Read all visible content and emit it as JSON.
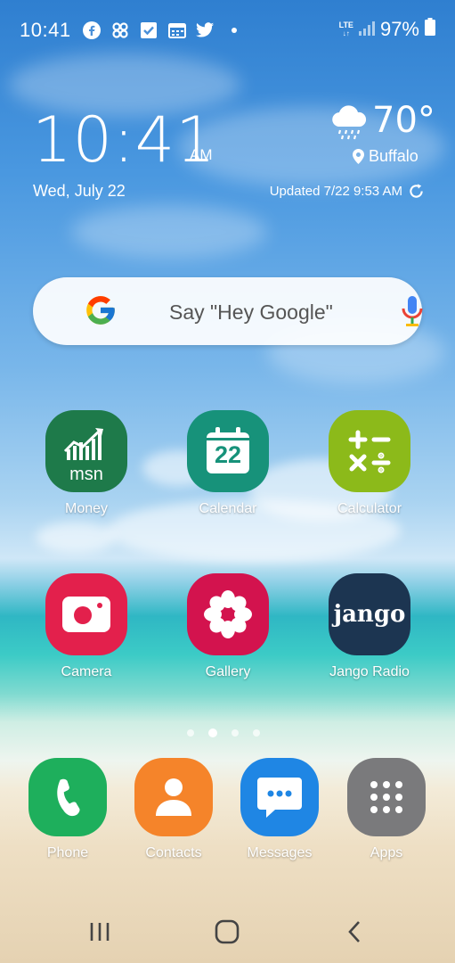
{
  "status_bar": {
    "time": "10:41",
    "network": "LTE",
    "battery": "97%",
    "icons": [
      "facebook-icon",
      "pinwheel-icon",
      "check-icon",
      "calendar-icon",
      "twitter-icon",
      "dot-icon"
    ]
  },
  "clock_widget": {
    "time": "10:41",
    "ampm": "AM",
    "date": "Wed, July 22"
  },
  "weather_widget": {
    "temperature": "70°",
    "location": "Buffalo",
    "updated": "Updated 7/22 9:53 AM",
    "icon": "rain-cloud-icon"
  },
  "search": {
    "placeholder": "Say \"Hey Google\""
  },
  "apps": [
    {
      "label": "Money",
      "color": "#1e7a4a"
    },
    {
      "label": "Calendar",
      "color": "#17927a",
      "day": "22"
    },
    {
      "label": "Calculator",
      "color": "#8cba1a"
    },
    {
      "label": "Camera",
      "color": "#e3204c"
    },
    {
      "label": "Gallery",
      "color": "#d3134e"
    },
    {
      "label": "Jango Radio",
      "color": "#1c3551",
      "logo_text": "jango"
    }
  ],
  "money_icon_text": "msn",
  "dock": [
    {
      "label": "Phone",
      "color": "#1eaf5c"
    },
    {
      "label": "Contacts",
      "color": "#f5842a"
    },
    {
      "label": "Messages",
      "color": "#1f86e4"
    },
    {
      "label": "Apps",
      "color": "#7a7a7c"
    }
  ],
  "page_indicator": {
    "pages": 4,
    "active": 2
  }
}
